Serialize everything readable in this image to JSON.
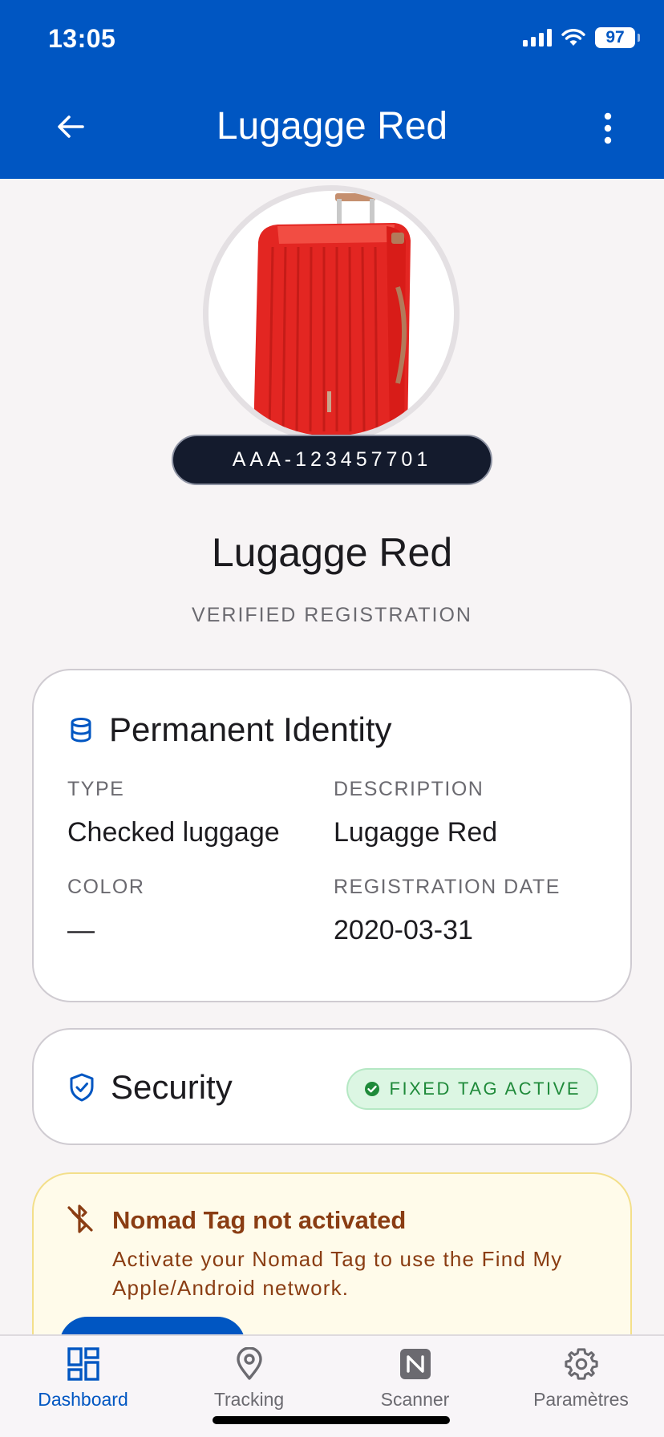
{
  "status_bar": {
    "time": "13:05",
    "battery": "97"
  },
  "header": {
    "title": "Lugagge Red"
  },
  "item": {
    "tag_id": "AAA-123457701",
    "name": "Lugagge Red",
    "status": "VERIFIED REGISTRATION"
  },
  "identity_card": {
    "title": "Permanent Identity",
    "fields": [
      {
        "label": "TYPE",
        "value": "Checked luggage"
      },
      {
        "label": "DESCRIPTION",
        "value": "Lugagge Red"
      },
      {
        "label": "COLOR",
        "value": "—"
      },
      {
        "label": "REGISTRATION DATE",
        "value": "2020-03-31"
      }
    ]
  },
  "security_card": {
    "title": "Security",
    "badge": "FIXED TAG ACTIVE"
  },
  "warning_card": {
    "title": "Nomad Tag not activated",
    "text": "Activate your Nomad Tag to use the Find My Apple/Android network."
  },
  "bottom_nav": {
    "items": [
      {
        "label": "Dashboard",
        "icon": "dashboard-icon",
        "active": true
      },
      {
        "label": "Tracking",
        "icon": "location-pin-icon",
        "active": false
      },
      {
        "label": "Scanner",
        "icon": "nfc-icon",
        "active": false
      },
      {
        "label": "Paramètres",
        "icon": "gear-icon",
        "active": false
      }
    ]
  },
  "colors": {
    "primary": "#0056c2",
    "badge_green": "#1f8a3a",
    "warning_text": "#8a3d13",
    "warning_bg": "#fffbea"
  }
}
